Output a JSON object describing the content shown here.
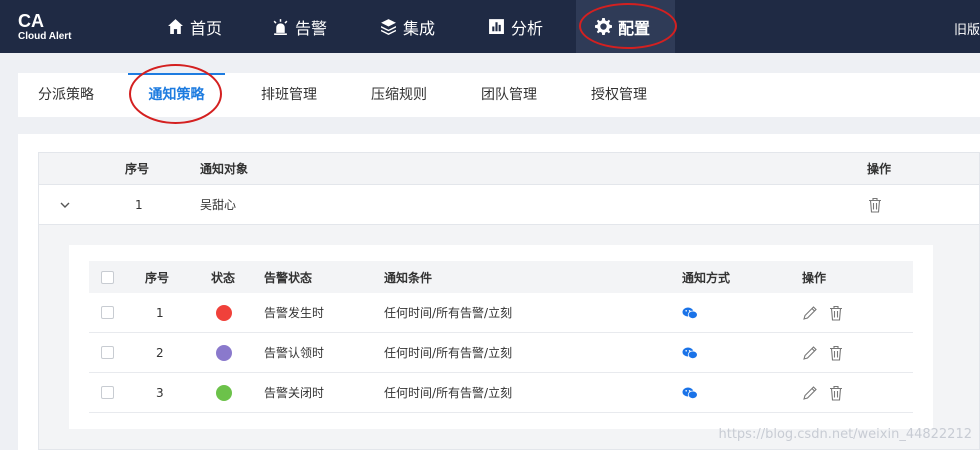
{
  "brand": {
    "title": "CA",
    "subtitle": "Cloud Alert"
  },
  "nav": {
    "items": [
      {
        "label": "首页",
        "icon": "home-icon"
      },
      {
        "label": "告警",
        "icon": "alarm-icon"
      },
      {
        "label": "集成",
        "icon": "layers-icon"
      },
      {
        "label": "分析",
        "icon": "chart-icon"
      },
      {
        "label": "配置",
        "icon": "gear-icon",
        "active": true
      }
    ],
    "old_version": "旧版"
  },
  "tabs": [
    {
      "label": "分派策略"
    },
    {
      "label": "通知策略",
      "active": true
    },
    {
      "label": "排班管理"
    },
    {
      "label": "压缩规则"
    },
    {
      "label": "团队管理"
    },
    {
      "label": "授权管理"
    }
  ],
  "outer_table": {
    "headers": {
      "index": "序号",
      "target": "通知对象",
      "actions": "操作"
    },
    "row": {
      "index": "1",
      "target": "吴甜心"
    }
  },
  "inner_table": {
    "headers": {
      "index": "序号",
      "status": "状态",
      "alert_status": "告警状态",
      "condition": "通知条件",
      "method": "通知方式",
      "actions": "操作"
    },
    "rows": [
      {
        "index": "1",
        "status_color": "#f0413a",
        "alert_status": "告警发生时",
        "condition": "任何时间/所有告警/立刻"
      },
      {
        "index": "2",
        "status_color": "#8a79cc",
        "alert_status": "告警认领时",
        "condition": "任何时间/所有告警/立刻"
      },
      {
        "index": "3",
        "status_color": "#6cc24a",
        "alert_status": "告警关闭时",
        "condition": "任何时间/所有告警/立刻"
      }
    ]
  },
  "colors": {
    "nav_bg": "#1f2a44",
    "accent": "#1e7ce0",
    "wechat": "#1a73e8",
    "annotation": "#d42020"
  },
  "watermark": "https://blog.csdn.net/weixin_44822212"
}
